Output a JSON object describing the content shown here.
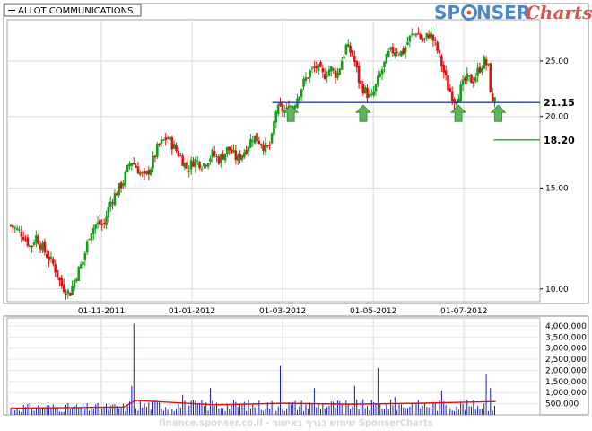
{
  "legend": {
    "ticker": "ALLOT COMMUNICATIONS"
  },
  "logo": {
    "part1": "SP",
    "part2": "NSER",
    "part3": "Charts"
  },
  "footer": {
    "text": "finance.sponser.co.il - שימוש בגרף באישור SponserCharts"
  },
  "colors": {
    "up": "#1a9a1a",
    "down": "#e01010",
    "support_line": "#1f3fa0",
    "volume": "#1a1ab0",
    "volume_ma": "#e01010",
    "arrow": "#5cb85c",
    "grid": "#d8d8d8"
  },
  "chart_data": [
    {
      "type": "candlestick",
      "price_scale": "log",
      "ylim": [
        9.5,
        29.5
      ],
      "y_ticks": [
        {
          "value": 10,
          "label": "10.00"
        },
        {
          "value": 15,
          "label": "15.00"
        },
        {
          "value": 20,
          "label": "20.00"
        },
        {
          "value": 25,
          "label": "25.00"
        }
      ],
      "x_ticks": [
        "01-11-2011",
        "01-01-2012",
        "01-03-2012",
        "01-05-2012",
        "01-07-2012"
      ],
      "x_tick_months": [
        2,
        4,
        6,
        8,
        10
      ],
      "x_range_months": [
        0,
        11.6
      ],
      "grid": true,
      "anchors": [
        [
          0.0,
          12.9
        ],
        [
          0.25,
          12.5
        ],
        [
          0.45,
          11.8
        ],
        [
          0.55,
          12.4
        ],
        [
          0.75,
          11.6
        ],
        [
          0.95,
          11.0
        ],
        [
          1.1,
          10.2
        ],
        [
          1.3,
          9.8
        ],
        [
          1.45,
          10.6
        ],
        [
          1.6,
          11.2
        ],
        [
          1.75,
          12.6
        ],
        [
          1.9,
          13.0
        ],
        [
          2.05,
          12.9
        ],
        [
          2.2,
          14.2
        ],
        [
          2.35,
          14.8
        ],
        [
          2.5,
          15.5
        ],
        [
          2.65,
          16.8
        ],
        [
          2.8,
          16.2
        ],
        [
          2.95,
          15.6
        ],
        [
          3.1,
          16.4
        ],
        [
          3.25,
          17.7
        ],
        [
          3.45,
          18.4
        ],
        [
          3.6,
          17.7
        ],
        [
          3.75,
          17.0
        ],
        [
          3.9,
          16.2
        ],
        [
          4.05,
          16.8
        ],
        [
          4.25,
          16.5
        ],
        [
          4.45,
          17.2
        ],
        [
          4.6,
          16.8
        ],
        [
          4.8,
          17.6
        ],
        [
          5.0,
          16.8
        ],
        [
          5.2,
          17.6
        ],
        [
          5.35,
          18.5
        ],
        [
          5.5,
          18.1
        ],
        [
          5.65,
          17.5
        ],
        [
          5.75,
          18.0
        ],
        [
          5.85,
          20.5
        ],
        [
          5.95,
          20.6
        ],
        [
          6.1,
          20.4
        ],
        [
          6.25,
          21.0
        ],
        [
          6.45,
          22.8
        ],
        [
          6.6,
          23.9
        ],
        [
          6.75,
          24.4
        ],
        [
          6.9,
          23.5
        ],
        [
          7.05,
          24.3
        ],
        [
          7.2,
          23.6
        ],
        [
          7.3,
          25.0
        ],
        [
          7.4,
          26.5
        ],
        [
          7.55,
          25.6
        ],
        [
          7.7,
          22.8
        ],
        [
          7.85,
          22.0
        ],
        [
          7.95,
          21.4
        ],
        [
          8.05,
          22.5
        ],
        [
          8.2,
          24.2
        ],
        [
          8.35,
          25.8
        ],
        [
          8.5,
          26.2
        ],
        [
          8.65,
          25.8
        ],
        [
          8.8,
          27.4
        ],
        [
          8.95,
          28.1
        ],
        [
          9.1,
          27.0
        ],
        [
          9.25,
          28.0
        ],
        [
          9.4,
          26.3
        ],
        [
          9.55,
          24.0
        ],
        [
          9.65,
          22.5
        ],
        [
          9.8,
          21.3
        ],
        [
          9.95,
          22.5
        ],
        [
          10.05,
          23.3
        ],
        [
          10.2,
          23.1
        ],
        [
          10.35,
          24.3
        ],
        [
          10.45,
          25.0
        ],
        [
          10.55,
          24.2
        ],
        [
          10.62,
          20.7
        ],
        [
          10.68,
          21.8
        ]
      ],
      "levels": [
        {
          "value": 21.15,
          "label": "21.15",
          "from_month": 5.85,
          "style": "solid-blue"
        },
        {
          "value": 18.2,
          "label": "18.20",
          "from_month": 10.7,
          "style": "short-green"
        }
      ],
      "arrows_months": [
        6.1,
        7.7,
        9.8,
        10.68
      ]
    },
    {
      "type": "bar",
      "series": [
        "volume"
      ],
      "ylim": [
        0,
        4200000
      ],
      "y_ticks": [
        {
          "value": 500000,
          "label": "500,000"
        },
        {
          "value": 1000000,
          "label": "1,000,000"
        },
        {
          "value": 1500000,
          "label": "1,500,000"
        },
        {
          "value": 2000000,
          "label": "2,000,000"
        },
        {
          "value": 2500000,
          "label": "2,500,000"
        },
        {
          "value": 3000000,
          "label": "3,000,000"
        },
        {
          "value": 3500000,
          "label": "3,500,000"
        },
        {
          "value": 4000000,
          "label": "4,000,000"
        }
      ],
      "spikes": [
        [
          2.72,
          4100000
        ],
        [
          2.68,
          1300000
        ],
        [
          5.95,
          2200000
        ],
        [
          8.1,
          2100000
        ],
        [
          10.48,
          1850000
        ],
        [
          10.6,
          1200000
        ],
        [
          6.7,
          1200000
        ],
        [
          7.6,
          1300000
        ],
        [
          4.4,
          1200000
        ],
        [
          9.5,
          1100000
        ],
        [
          3.8,
          900000
        ],
        [
          8.5,
          800000
        ]
      ],
      "base_level": 300000,
      "ma_level": [
        [
          0,
          300000
        ],
        [
          2.5,
          350000
        ],
        [
          2.75,
          650000
        ],
        [
          4.5,
          450000
        ],
        [
          6.0,
          520000
        ],
        [
          7.5,
          480000
        ],
        [
          9.0,
          520000
        ],
        [
          10.7,
          600000
        ]
      ]
    }
  ]
}
